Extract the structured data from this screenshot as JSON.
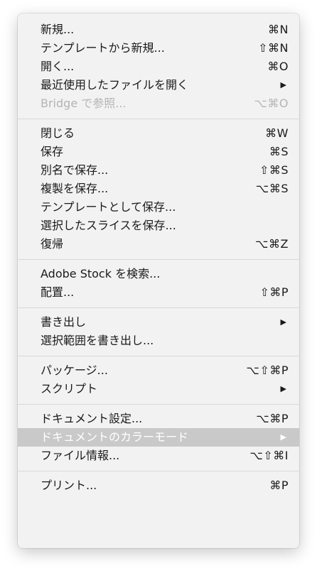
{
  "menu": {
    "groups": [
      [
        {
          "label": "新規...",
          "shortcut": "⌘N"
        },
        {
          "label": "テンプレートから新規...",
          "shortcut": "⇧⌘N"
        },
        {
          "label": "開く...",
          "shortcut": "⌘O"
        },
        {
          "label": "最近使用したファイルを開く",
          "submenu": "▶"
        },
        {
          "label": "Bridge で参照...",
          "shortcut": "⌥⌘O",
          "disabled": true
        }
      ],
      [
        {
          "label": "閉じる",
          "shortcut": "⌘W"
        },
        {
          "label": "保存",
          "shortcut": "⌘S"
        },
        {
          "label": "別名で保存...",
          "shortcut": "⇧⌘S"
        },
        {
          "label": "複製を保存...",
          "shortcut": "⌥⌘S"
        },
        {
          "label": "テンプレートとして保存..."
        },
        {
          "label": "選択したスライスを保存..."
        },
        {
          "label": "復帰",
          "shortcut": "⌥⌘Z"
        }
      ],
      [
        {
          "label": "Adobe Stock を検索..."
        },
        {
          "label": "配置...",
          "shortcut": "⇧⌘P"
        }
      ],
      [
        {
          "label": "書き出し",
          "submenu": "▶"
        },
        {
          "label": "選択範囲を書き出し..."
        }
      ],
      [
        {
          "label": "パッケージ...",
          "shortcut": "⌥⇧⌘P"
        },
        {
          "label": "スクリプト",
          "submenu": "▶"
        }
      ],
      [
        {
          "label": "ドキュメント設定...",
          "shortcut": "⌥⌘P"
        },
        {
          "label": "ドキュメントのカラーモード",
          "submenu": "▶",
          "highlighted": true
        },
        {
          "label": "ファイル情報...",
          "shortcut": "⌥⇧⌘I"
        }
      ],
      [
        {
          "label": "プリント...",
          "shortcut": "⌘P"
        }
      ]
    ]
  }
}
